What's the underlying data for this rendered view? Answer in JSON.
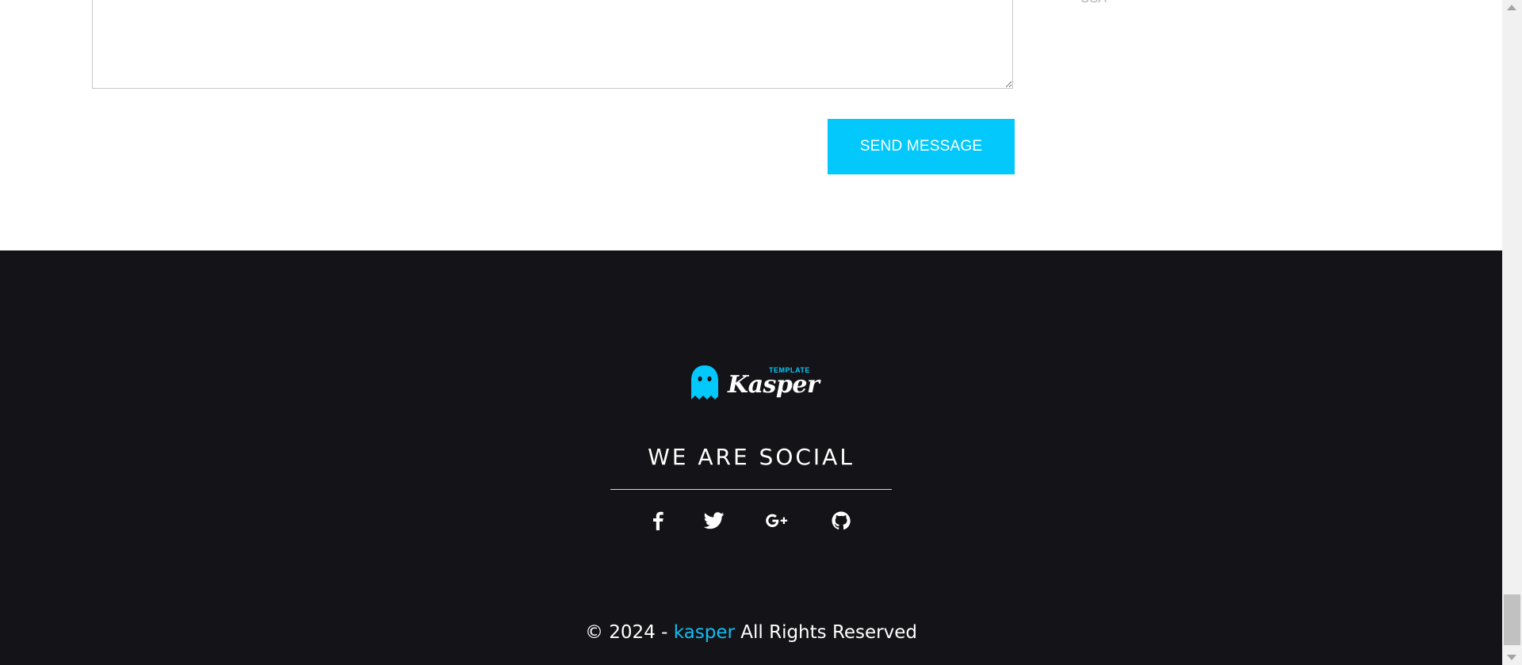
{
  "contact": {
    "message_value": "",
    "info_text": "USA",
    "send_label": "SEND MESSAGE"
  },
  "footer": {
    "logo": {
      "word": "Kasper",
      "tag": "TEMPLATE"
    },
    "social_title": "WE ARE SOCIAL",
    "social_icons": [
      "facebook-icon",
      "twitter-icon",
      "google-plus-icon",
      "github-icon"
    ],
    "copyright": {
      "prefix": "© 2024 - ",
      "brand": "kasper",
      "suffix": " All Rights Reserved"
    }
  },
  "colors": {
    "accent": "#03c8fb",
    "footer_bg": "#141318",
    "page_bg": "#ffffff"
  }
}
